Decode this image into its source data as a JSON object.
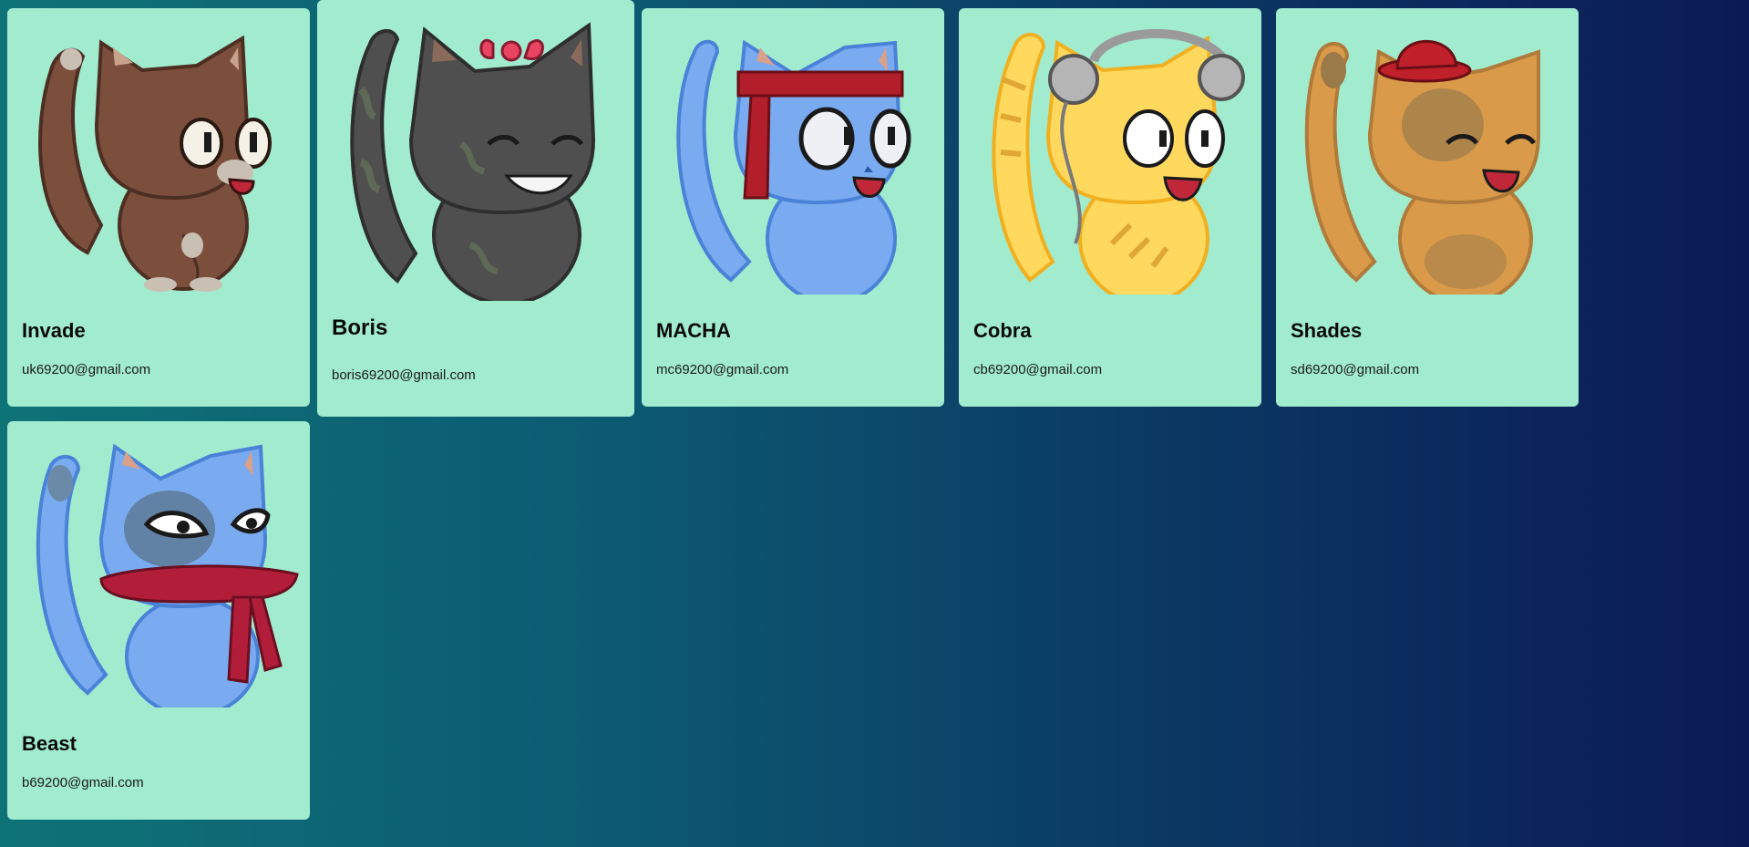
{
  "cards": [
    {
      "name": "Invade",
      "email": "uk69200@gmail.com",
      "avatar": "brown-cat-icon",
      "fur": "#7b4f3c",
      "accent": "#d9c9b6"
    },
    {
      "name": "Boris",
      "email": "boris69200@gmail.com",
      "avatar": "gray-cat-with-bow-icon",
      "fur": "#4f4f4f",
      "accent": "#e94563"
    },
    {
      "name": "MACHA",
      "email": "mc69200@gmail.com",
      "avatar": "blue-cat-with-headband-icon",
      "fur": "#7aaaf0",
      "accent": "#b21e2a"
    },
    {
      "name": "Cobra",
      "email": "cb69200@gmail.com",
      "avatar": "yellow-cat-with-headphones-icon",
      "fur": "#ffd85e",
      "accent": "#9a9a9a"
    },
    {
      "name": "Shades",
      "email": "sd69200@gmail.com",
      "avatar": "orange-cat-with-hat-icon",
      "fur": "#d99a4a",
      "accent": "#c0202a"
    },
    {
      "name": "Beast",
      "email": "b69200@gmail.com",
      "avatar": "blue-cat-with-scarf-icon",
      "fur": "#7aaaf0",
      "accent": "#b21e3a"
    }
  ]
}
